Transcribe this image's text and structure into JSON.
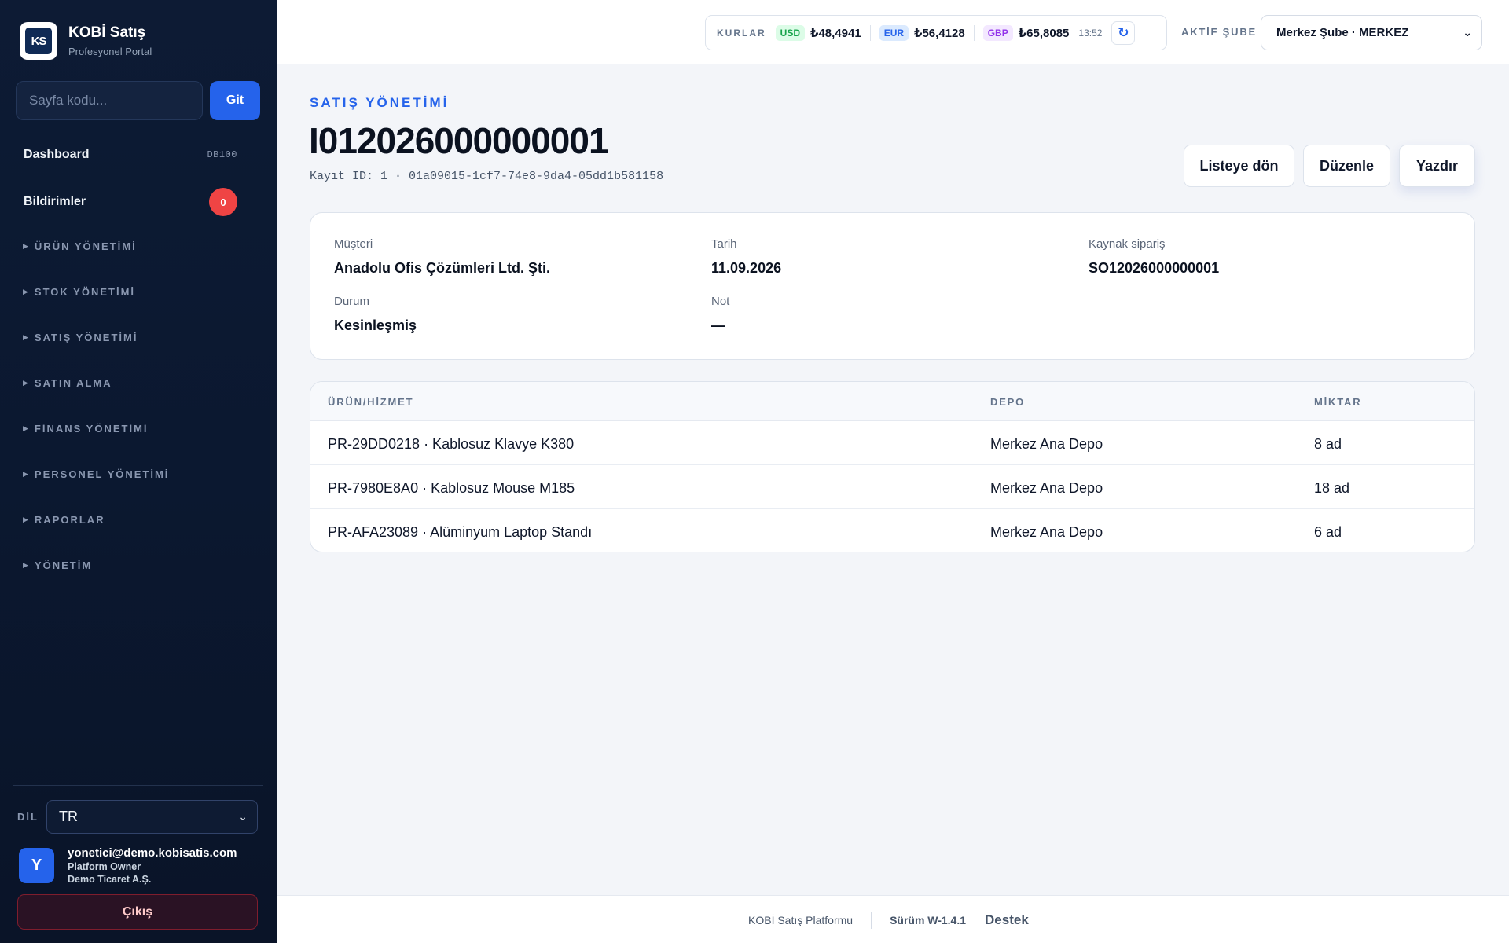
{
  "brand": {
    "logo_text": "KS",
    "title": "KOBİ Satış",
    "subtitle": "Profesyonel Portal"
  },
  "goto": {
    "placeholder": "Sayfa kodu...",
    "button": "Git"
  },
  "nav": {
    "dashboard": {
      "label": "Dashboard",
      "code": "DB100"
    },
    "notifications": {
      "label": "Bildirimler",
      "count": "0"
    },
    "sections": [
      "ÜRÜN YÖNETİMİ",
      "STOK YÖNETİMİ",
      "SATIŞ YÖNETİMİ",
      "SATIN ALMA",
      "FİNANS YÖNETİMİ",
      "PERSONEL YÖNETİMİ",
      "RAPORLAR",
      "YÖNETİM"
    ]
  },
  "language": {
    "label": "DİL",
    "value": "TR"
  },
  "user": {
    "initial": "Y",
    "email": "yonetici@demo.kobisatis.com",
    "role": "Platform Owner",
    "company": "Demo Ticaret A.Ş."
  },
  "logout_label": "Çıkış",
  "rates": {
    "label": "KURLAR",
    "usd": {
      "code": "USD",
      "value": "₺48,4941",
      "color": "#16a34a"
    },
    "eur": {
      "code": "EUR",
      "value": "₺56,4128",
      "color": "#2563eb"
    },
    "gbp": {
      "code": "GBP",
      "value": "₺65,8085",
      "color": "#9333ea"
    },
    "time": "13:52"
  },
  "branch": {
    "label": "AKTİF ŞUBE",
    "value": "Merkez Şube · MERKEZ"
  },
  "page": {
    "eyebrow": "SATIŞ YÖNETİMİ",
    "title": "I012026000000001",
    "record_id": "Kayıt ID: 1 · 01a09015-1cf7-74e8-9da4-05dd1b581158"
  },
  "actions": {
    "back": "Listeye dön",
    "edit": "Düzenle",
    "print": "Yazdır"
  },
  "details": {
    "customer": {
      "label": "Müşteri",
      "value": "Anadolu Ofis Çözümleri Ltd. Şti."
    },
    "date": {
      "label": "Tarih",
      "value": "11.09.2026"
    },
    "source_order": {
      "label": "Kaynak sipariş",
      "value": "SO12026000000001"
    },
    "status": {
      "label": "Durum",
      "value": "Kesinleşmiş"
    },
    "note": {
      "label": "Not",
      "value": "—"
    }
  },
  "table": {
    "headers": [
      "ÜRÜN/HİZMET",
      "DEPO",
      "MİKTAR"
    ],
    "rows": [
      [
        "PR-29DD0218 · Kablosuz Klavye K380",
        "Merkez Ana Depo",
        "8 ad"
      ],
      [
        "PR-7980E8A0 · Kablosuz Mouse M185",
        "Merkez Ana Depo",
        "18 ad"
      ],
      [
        "PR-AFA23089 · Alüminyum Laptop Standı",
        "Merkez Ana Depo",
        "6 ad"
      ]
    ]
  },
  "footer": {
    "platform": "KOBİ Satış Platformu",
    "version": "Sürüm W-1.4.1",
    "support": "Destek"
  },
  "colors": {
    "sidebar": "#0d1b34",
    "accent": "#2563eb",
    "danger": "#ef4444"
  }
}
